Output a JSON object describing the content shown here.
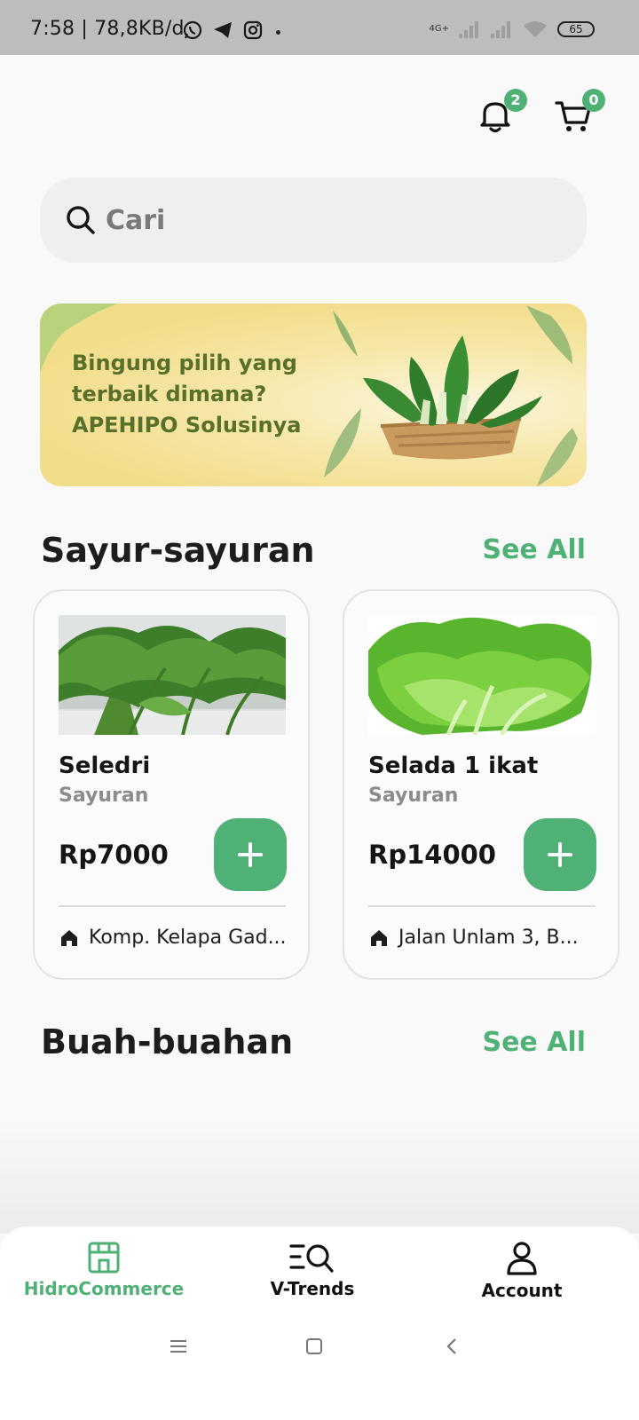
{
  "status_bar": {
    "time_speed": "7:58 | 78,8KB/d",
    "network_type": "4G+",
    "battery": "65"
  },
  "header": {
    "notifications_count": "2",
    "cart_count": "0"
  },
  "search": {
    "placeholder": "Cari"
  },
  "banner": {
    "line1": "Bingung pilih yang",
    "line2": "terbaik dimana?",
    "line3": "APEHIPO Solusinya"
  },
  "sections": {
    "vegetables_title": "Sayur-sayuran",
    "fruits_title": "Buah-buahan",
    "see_all": "See All"
  },
  "products": [
    {
      "name": "Seledri",
      "category": "Sayuran",
      "price": "Rp7000",
      "location": "Komp. Kelapa Gad..."
    },
    {
      "name": "Selada 1 ikat",
      "category": "Sayuran",
      "price": "Rp14000",
      "location": "Jalan Unlam 3, B..."
    }
  ],
  "bottom_nav": {
    "home": "HidroCommerce",
    "trends": "V-Trends",
    "account": "Account"
  },
  "colors": {
    "accent": "#4fb176",
    "banner_text": "#58702a",
    "banner_bg": "#f2dd8a"
  }
}
